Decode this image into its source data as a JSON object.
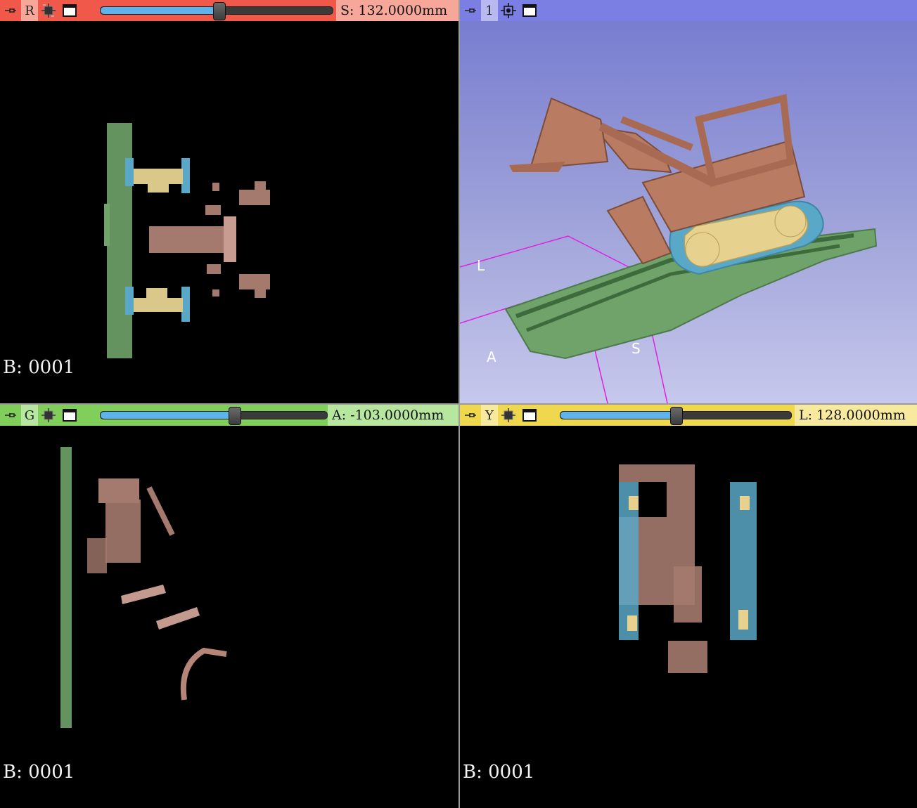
{
  "views": {
    "red": {
      "letter": "R",
      "readout": "S:  132.0000mm",
      "slider_fraction": 0.51,
      "corner": "B: 0001",
      "color": "#f0584a"
    },
    "threed": {
      "letter": "1",
      "color": "#7b7fe3"
    },
    "green": {
      "letter": "G",
      "readout": "A:  -103.0000mm",
      "slider_fraction": 0.59,
      "corner": "B: 0001",
      "color": "#7fcf5a"
    },
    "yellow": {
      "letter": "Y",
      "readout": "L:  128.0000mm",
      "slider_fraction": 0.5,
      "corner": "B: 0001",
      "color": "#f0d84e"
    }
  },
  "orientation_labels": {
    "left": "L",
    "anterior": "A",
    "superior": "S"
  },
  "icons": [
    "pin-icon",
    "link-icon",
    "layout-icon",
    "maximize-icon",
    "center-view-icon"
  ],
  "segment_colors": {
    "track_base": "#6fa36a",
    "body": "#b97b62",
    "wheels": "#e6d18f",
    "tread": "#5aa8c7"
  }
}
